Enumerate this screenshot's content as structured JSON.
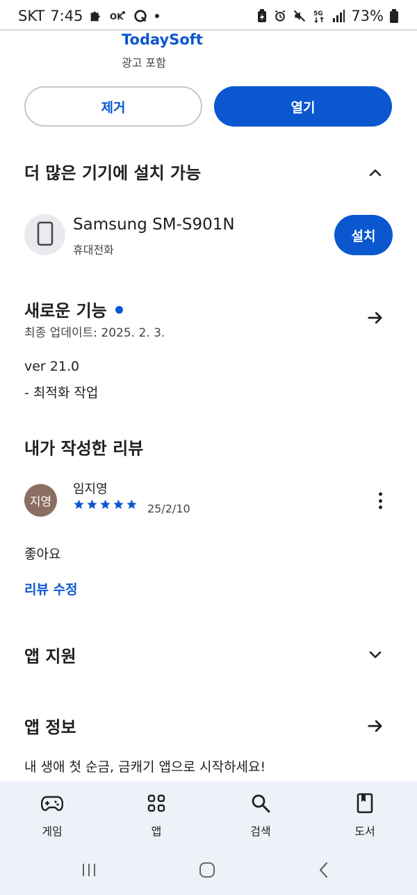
{
  "status_bar": {
    "carrier": "SKT",
    "time": "7:45",
    "battery": "73%",
    "left_icons": [
      "puzzle-icon",
      "ok-cashbag-icon",
      "q-app-icon",
      "dot-icon"
    ],
    "right_icons": [
      "battery-saver-icon",
      "alarm-icon",
      "mute-icon",
      "5g-icon",
      "signal-icon",
      "battery-icon"
    ],
    "network": "5G"
  },
  "app": {
    "developer": "TodaySoft",
    "ads_label": "광고 포함"
  },
  "actions": {
    "remove_label": "제거",
    "open_label": "열기"
  },
  "devices_section": {
    "title": "더 많은 기기에 설치 가능",
    "device_name": "Samsung SM-S901N",
    "device_type": "휴대전화",
    "install_label": "설치"
  },
  "whats_new": {
    "title": "새로운 기능",
    "updated": "최종 업데이트: 2025. 2. 3.",
    "version": "ver 21.0",
    "changes": "- 최적화 작업"
  },
  "my_review": {
    "title": "내가 작성한 리뷰",
    "avatar_text": "지영",
    "reviewer": "임지영",
    "rating": 5,
    "date": "25/2/10",
    "text": "좋아요",
    "edit_label": "리뷰 수정"
  },
  "app_support": {
    "title": "앱 지원"
  },
  "app_info": {
    "title": "앱 정보",
    "description": "내 생애 첫 순금, 금캐기 앱으로 시작하세요!"
  },
  "bottom_nav": {
    "items": [
      {
        "label": "게임",
        "icon": "gamepad-icon"
      },
      {
        "label": "앱",
        "icon": "apps-grid-icon"
      },
      {
        "label": "검색",
        "icon": "search-icon"
      },
      {
        "label": "도서",
        "icon": "book-icon"
      }
    ]
  },
  "system_nav": [
    "recents-icon",
    "home-icon",
    "back-icon"
  ],
  "colors": {
    "accent": "#0b57d0",
    "nav_background": "#eef1f8",
    "avatar_brown": "#8d6e63"
  }
}
